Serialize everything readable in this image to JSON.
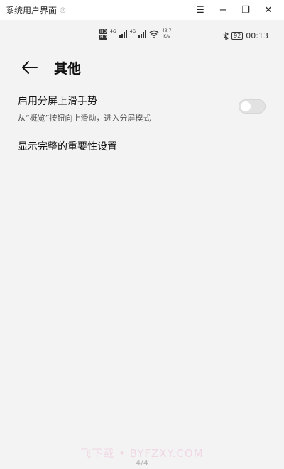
{
  "window": {
    "title": "系统用户界面",
    "pin_glyph": "◎",
    "controls": {
      "menu": "☰",
      "minimize": "−",
      "restore": "❐",
      "close": "✕"
    }
  },
  "status_bar": {
    "hd_badges": [
      "HD",
      "HD"
    ],
    "gen_labels": [
      "4G",
      "4G"
    ],
    "net_speed_value": "43.7",
    "net_speed_unit": "K/s",
    "battery": "92",
    "time": "00:13"
  },
  "header": {
    "title": "其他"
  },
  "settings": {
    "split_screen": {
      "title": "启用分屏上滑手势",
      "subtitle": "从“概览”按钮向上滑动，进入分屏模式",
      "toggle_on": false
    },
    "importance": {
      "title": "显示完整的重要性设置"
    }
  },
  "watermark": "飞下载 • BYFZXY.COM",
  "page_indicator": "4/4",
  "colors": {
    "background": "#f3f3f3",
    "toggle_off": "#e2e2e2"
  }
}
